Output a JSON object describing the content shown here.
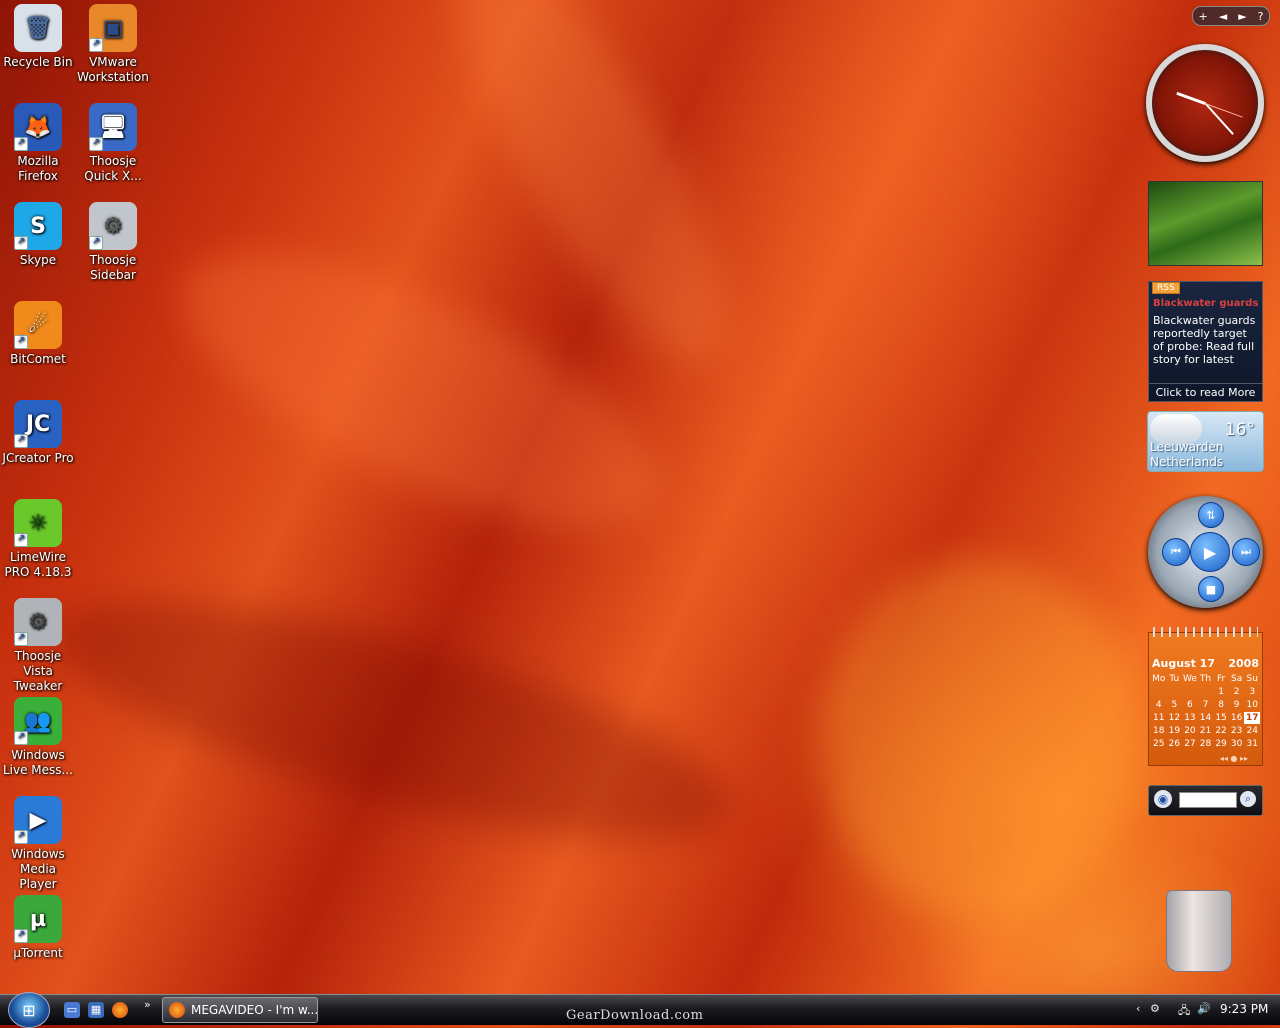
{
  "desktop": {
    "icons": [
      {
        "label": "Recycle Bin",
        "glyph": "🗑",
        "bg": "#d8e0ea",
        "fg": "#4a6a9a",
        "shortcut": false
      },
      {
        "label": "VMware Workstation",
        "glyph": "▣",
        "bg": "#e8882a",
        "fg": "#2a4a8a",
        "shortcut": true
      },
      {
        "label": "Mozilla Firefox",
        "glyph": "🦊",
        "bg": "#2a5ab8",
        "fg": "#ff8a20",
        "shortcut": true
      },
      {
        "label": "Thoosje Quick X...",
        "glyph": "🖥",
        "bg": "#3a6ac8",
        "fg": "#fff",
        "shortcut": true
      },
      {
        "label": "Skype",
        "glyph": "S",
        "bg": "#1fa8e8",
        "fg": "#fff",
        "shortcut": true
      },
      {
        "label": "Thoosje Sidebar",
        "glyph": "⚙",
        "bg": "#c0c6cc",
        "fg": "#555",
        "shortcut": true
      },
      {
        "label": "BitComet",
        "glyph": "☄",
        "bg": "#f08a1a",
        "fg": "#fff",
        "shortcut": true
      },
      {
        "label": "JCreator Pro",
        "glyph": "JC",
        "bg": "#2a62c2",
        "fg": "#fff",
        "shortcut": true
      },
      {
        "label": "LimeWire PRO 4.18.3",
        "glyph": "✳",
        "bg": "#6ac82a",
        "fg": "#1a5a10",
        "shortcut": true
      },
      {
        "label": "Thoosje Vista Tweaker",
        "glyph": "⚙",
        "bg": "#b0b4b8",
        "fg": "#444",
        "shortcut": true
      },
      {
        "label": "Windows Live Mess...",
        "glyph": "👥",
        "bg": "#3ab03a",
        "fg": "#fff",
        "shortcut": true
      },
      {
        "label": "Windows Media Player",
        "glyph": "▶",
        "bg": "#2a7ad8",
        "fg": "#fff",
        "shortcut": true
      },
      {
        "label": "µTorrent",
        "glyph": "µ",
        "bg": "#3aa83a",
        "fg": "#fff",
        "shortcut": true
      }
    ]
  },
  "sidebar": {
    "controls": {
      "add": "+",
      "prev": "◄",
      "next": "►",
      "help": "?"
    },
    "rss": {
      "tag": "RSS",
      "headline": "Blackwater guards",
      "body": "Blackwater guards reportedly target of probe: Read full story for latest",
      "footer": "Click to read More"
    },
    "weather": {
      "temp": "16°",
      "city": "Leeuwarden",
      "country": "Netherlands"
    },
    "calendar": {
      "month": "August 17",
      "year": "2008",
      "weekdays": [
        "Mo",
        "Tu",
        "We",
        "Th",
        "Fr",
        "Sa",
        "Su"
      ],
      "days": [
        "",
        "",
        "",
        "",
        "1",
        "2",
        "3",
        "4",
        "5",
        "6",
        "7",
        "8",
        "9",
        "10",
        "11",
        "12",
        "13",
        "14",
        "15",
        "16",
        "17",
        "18",
        "19",
        "20",
        "21",
        "22",
        "23",
        "24",
        "25",
        "26",
        "27",
        "28",
        "29",
        "30",
        "31"
      ],
      "today": "17",
      "nav": "◂◂  ●  ▸▸"
    }
  },
  "taskbar": {
    "task_label": "MEGAVIDEO - I'm w...",
    "watermark": "GearDownload.com",
    "time": "9:23 PM",
    "overflow": "»",
    "tray_chevron": "‹"
  }
}
